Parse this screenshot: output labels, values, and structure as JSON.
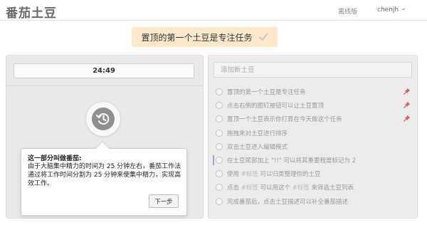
{
  "header": {
    "app_title": "番茄土豆",
    "offline_label": "离线版",
    "user": "chenjh",
    "dropdown_glyph": "⌄"
  },
  "banner": {
    "text": "置顶的第一个土豆是专注任务",
    "icon": "check-icon"
  },
  "timer": {
    "display": "24:49"
  },
  "start_button": {
    "icon": "history-clock-icon"
  },
  "tooltip": {
    "title": "这一部分叫做番茄:",
    "body": "由于大脑集中精力的时间为 25 分钟左右，番茄工作法通过将工作时间分割为 25 分钟来使集中精力，实现高效工作。",
    "next_label": "下一步"
  },
  "todo": {
    "add_placeholder": "添加新土豆",
    "items": [
      {
        "parts": [
          {
            "text": "置顶的第一个土豆是专注任务",
            "tag": false
          }
        ],
        "pinned": true
      },
      {
        "parts": [
          {
            "text": "点击右侧的图钉按钮可以让土豆置顶",
            "tag": false
          }
        ],
        "pinned": true
      },
      {
        "parts": [
          {
            "text": "置顶一个土豆表示你打算在今天做这个任务",
            "tag": false
          }
        ],
        "pinned": true
      },
      {
        "parts": [
          {
            "text": "拖拽来对土豆进行排序",
            "tag": false
          }
        ],
        "pinned": false
      },
      {
        "parts": [
          {
            "text": "双击土豆进入编辑模式",
            "tag": false
          }
        ],
        "pinned": false
      },
      {
        "parts": [
          {
            "text": "在土豆尾部加上 \"!!\" 可以将其重要程度标记为 2",
            "tag": false
          }
        ],
        "pinned": false,
        "marked": true
      },
      {
        "parts": [
          {
            "text": "使用 ",
            "tag": false
          },
          {
            "text": "#标签",
            "tag": true
          },
          {
            "text": " 可以归类整理你的土豆",
            "tag": false
          }
        ],
        "pinned": false
      },
      {
        "parts": [
          {
            "text": "点击 ",
            "tag": false
          },
          {
            "text": "#标签",
            "tag": true
          },
          {
            "text": " 可以用这个 ",
            "tag": false
          },
          {
            "text": "#标签",
            "tag": true
          },
          {
            "text": " 来筛选土豆列表",
            "tag": false
          }
        ],
        "pinned": false
      },
      {
        "parts": [
          {
            "text": "完成番茄后，点击土豆描述可以补全番茄描述",
            "tag": false
          }
        ],
        "pinned": false
      }
    ]
  },
  "colors": {
    "banner_bg": "#fde8cc",
    "pin": "#e05a6a",
    "active_bar": "#a9a0c9",
    "check": "#c8c8c8"
  }
}
